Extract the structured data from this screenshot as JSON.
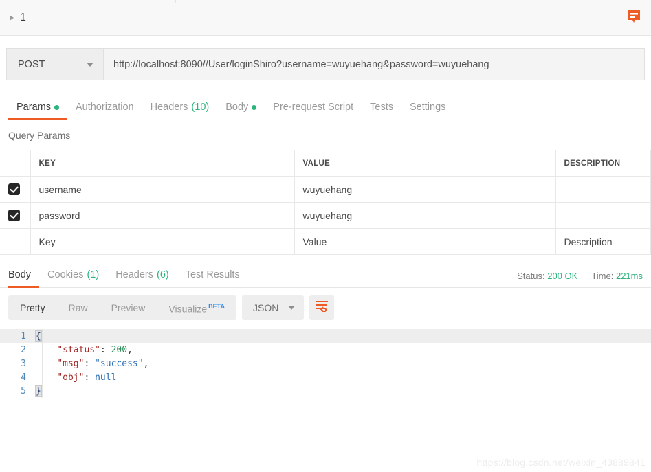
{
  "topbar": {
    "request_index": "1",
    "collapse_icon": "triangle-right-icon",
    "comment_icon": "comment-bubble-icon"
  },
  "url_bar": {
    "method": "POST",
    "method_caret": "chevron-down-icon",
    "url": "http://localhost:8090//User/loginShiro?username=wuyuehang&password=wuyuehang"
  },
  "request_tabs": [
    {
      "label": "Params",
      "badge": "",
      "dot": true,
      "active": true
    },
    {
      "label": "Authorization",
      "badge": "",
      "dot": false,
      "active": false
    },
    {
      "label": "Headers",
      "badge": "(10)",
      "dot": false,
      "active": false
    },
    {
      "label": "Body",
      "badge": "",
      "dot": true,
      "active": false
    },
    {
      "label": "Pre-request Script",
      "badge": "",
      "dot": false,
      "active": false
    },
    {
      "label": "Tests",
      "badge": "",
      "dot": false,
      "active": false
    },
    {
      "label": "Settings",
      "badge": "",
      "dot": false,
      "active": false
    }
  ],
  "query_params": {
    "section_label": "Query Params",
    "columns": [
      "KEY",
      "VALUE",
      "DESCRIPTION"
    ],
    "rows": [
      {
        "checked": true,
        "key": "username",
        "value": "wuyuehang",
        "description": ""
      },
      {
        "checked": true,
        "key": "password",
        "value": "wuyuehang",
        "description": ""
      }
    ],
    "placeholder_row": {
      "key": "Key",
      "value": "Value",
      "description": "Description"
    }
  },
  "response": {
    "tabs": [
      {
        "label": "Body",
        "badge": "",
        "active": true
      },
      {
        "label": "Cookies",
        "badge": "(1)",
        "active": false
      },
      {
        "label": "Headers",
        "badge": "(6)",
        "active": false
      },
      {
        "label": "Test Results",
        "badge": "",
        "active": false
      }
    ],
    "status_label": "Status:",
    "status_value": "200 OK",
    "time_label": "Time:",
    "time_value": "221ms",
    "view_modes": [
      {
        "label": "Pretty",
        "active": true
      },
      {
        "label": "Raw",
        "active": false
      },
      {
        "label": "Preview",
        "active": false
      },
      {
        "label": "Visualize",
        "active": false,
        "badge": "BETA"
      }
    ],
    "format": "JSON",
    "format_caret": "chevron-down-icon",
    "wrap_button_icon": "wrap-text-icon",
    "code_lines": [
      {
        "n": "1",
        "tokens": [
          {
            "t": "{",
            "c": "brace"
          }
        ]
      },
      {
        "n": "2",
        "tokens": [
          {
            "t": "    ",
            "c": "punc"
          },
          {
            "t": "\"status\"",
            "c": "key"
          },
          {
            "t": ": ",
            "c": "punc"
          },
          {
            "t": "200",
            "c": "num"
          },
          {
            "t": ",",
            "c": "punc"
          }
        ]
      },
      {
        "n": "3",
        "tokens": [
          {
            "t": "    ",
            "c": "punc"
          },
          {
            "t": "\"msg\"",
            "c": "key"
          },
          {
            "t": ": ",
            "c": "punc"
          },
          {
            "t": "\"success\"",
            "c": "str"
          },
          {
            "t": ",",
            "c": "punc"
          }
        ]
      },
      {
        "n": "4",
        "tokens": [
          {
            "t": "    ",
            "c": "punc"
          },
          {
            "t": "\"obj\"",
            "c": "key"
          },
          {
            "t": ": ",
            "c": "punc"
          },
          {
            "t": "null",
            "c": "null"
          }
        ]
      },
      {
        "n": "5",
        "tokens": [
          {
            "t": "}",
            "c": "brace"
          }
        ]
      }
    ]
  },
  "watermark": "https://blog.csdn.net/weixin_43889841",
  "colors": {
    "accent": "#ef5b25",
    "success": "#2db47d",
    "beta": "#2d8cf0",
    "checkbox": "#262626"
  }
}
